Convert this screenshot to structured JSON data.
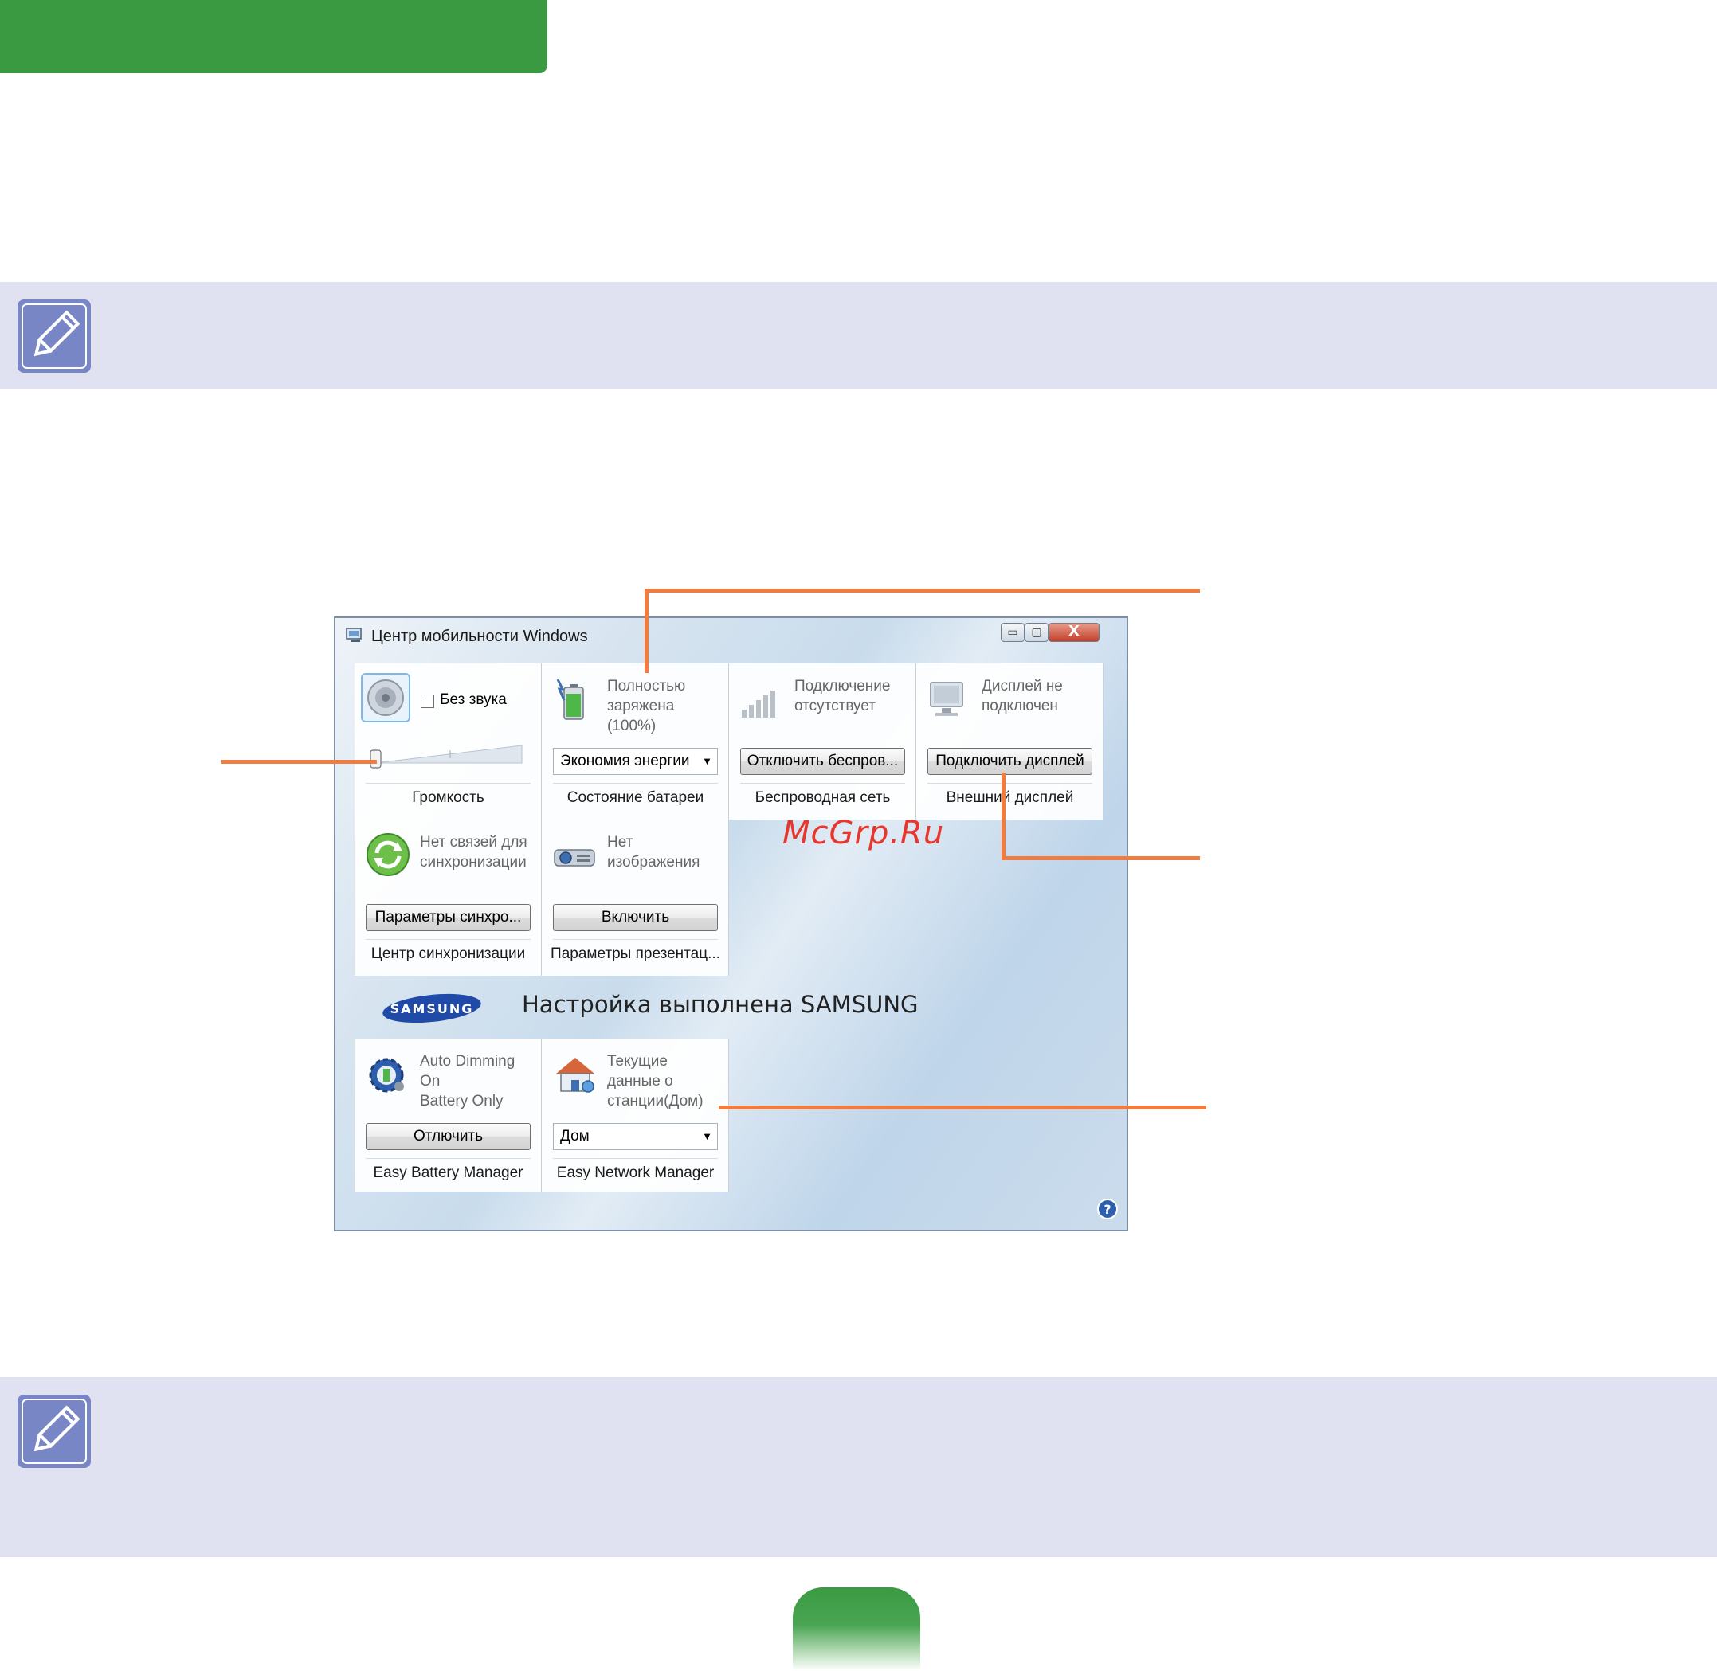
{
  "colors": {
    "header_green": "#3a9a42",
    "note_band": "#e0e2f1",
    "note_icon": "#7886c6",
    "callout_orange": "#ef7d41",
    "watermark_red": "#e8362d"
  },
  "icons": {
    "note": "pencil-note-icon",
    "app": "mobility-center-icon",
    "help": "help-icon"
  },
  "window": {
    "title": "Центр мобильности Windows",
    "controls": {
      "minimize": "▭",
      "maximize": "▢",
      "close": "X"
    }
  },
  "tiles": {
    "volume": {
      "checkbox_label": "Без звука",
      "checked": false,
      "slider_level": 0.0,
      "footer": "Громкость"
    },
    "battery": {
      "status": "Полностью\nзаряжена\n(100%)",
      "select_value": "Экономия энергии",
      "footer": "Состояние батареи"
    },
    "wireless": {
      "status": "Подключение\nотсутствует",
      "button": "Отключить беспров...",
      "footer": "Беспроводная сеть"
    },
    "display": {
      "status": "Дисплей не\nподключен",
      "button": "Подключить дисплей",
      "footer": "Внешний дисплей"
    },
    "sync": {
      "status": "Нет связей для\nсинхронизации",
      "button": "Параметры синхро...",
      "footer": "Центр синхронизации"
    },
    "presentation": {
      "status": "Нет\nизображения",
      "button": "Включить",
      "footer": "Параметры презентац..."
    },
    "easy_battery": {
      "status": "Auto Dimming\nOn\nBattery Only",
      "button": "Отлючить",
      "footer": "Easy Battery Manager"
    },
    "easy_network": {
      "status": "Текущие\nданные о\nстанции(Дом)",
      "select_value": "Дом",
      "footer": "Easy Network Manager"
    }
  },
  "samsung": {
    "logo_text": "SAMSUNG",
    "banner": "Настройка выполнена SAMSUNG"
  },
  "watermark": "McGrp.Ru"
}
